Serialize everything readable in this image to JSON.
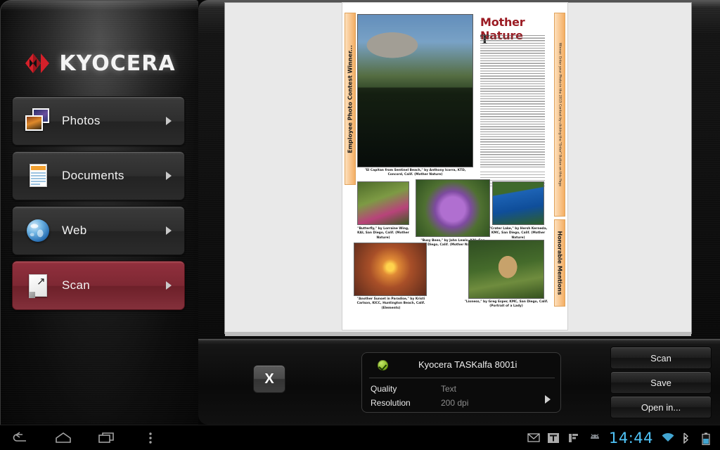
{
  "app": {
    "brand": "KYOCERA",
    "brand_logo_color": "#d4202a"
  },
  "sidebar": {
    "items": [
      {
        "label": "Photos",
        "icon": "photos-icon",
        "selected": false
      },
      {
        "label": "Documents",
        "icon": "documents-icon",
        "selected": false
      },
      {
        "label": "Web",
        "icon": "web-icon",
        "selected": false
      },
      {
        "label": "Scan",
        "icon": "scan-icon",
        "selected": true
      }
    ],
    "selected_color": "#7e2833"
  },
  "preview": {
    "document": {
      "headline": "Mother Nature",
      "headline_color": "#9b1b23",
      "left_banner": "Employee Photo Contest Winner...",
      "right_banner_top": "Winner: Enter your Photo in the 2015 Contest by clicking the \"Enter\" Button on this Page",
      "right_banner_bottom": "Honorable Mentions",
      "banner_color": "#f4ae63",
      "captions": [
        "\"El Capitan from Sentinel Beach,\" by Anthony Icorra, KTD, Concord, Calif. (Mother Nature)",
        "\"Butterfly,\" by Lorraine Wing, KAI, San Diego, Calif. (Mother Nature)",
        "\"Busy Bees,\" by John Lewis, KAI, San Diego, Calif. (Mother Nature)",
        "\"Crater Lake,\" by Hersh Kerneda, KMC, San Diego, Calif. (Mother Nature)",
        "\"Another Sunset in Paradise,\" by Kristi Carlson, KICC, Huntington Beach, Calif. (Elements)",
        "\"Lioness,\" by Greg Esper, KMC, San Diego, Calif. (Portrait of a Lady)"
      ],
      "dropcap": "T"
    }
  },
  "bottom": {
    "close_label": "X",
    "printer": {
      "name": "Kyocera TASKalfa 8001i",
      "status_icon": "check-circle-icon",
      "properties": [
        {
          "label": "Quality",
          "value": "Text"
        },
        {
          "label": "Resolution",
          "value": "200 dpi"
        }
      ]
    },
    "actions": [
      {
        "label": "Scan"
      },
      {
        "label": "Save"
      },
      {
        "label": "Open in..."
      }
    ]
  },
  "systembar": {
    "nav": [
      {
        "icon": "back-icon"
      },
      {
        "icon": "home-icon"
      },
      {
        "icon": "recents-icon"
      },
      {
        "icon": "overflow-menu-icon"
      }
    ],
    "status": [
      {
        "icon": "mail-icon"
      },
      {
        "icon": "text-app-icon"
      },
      {
        "icon": "chart-icon"
      },
      {
        "icon": "android-icon"
      }
    ],
    "clock": "14:44",
    "clock_color": "#4fc3f7",
    "indicators": [
      {
        "icon": "wifi-icon"
      },
      {
        "icon": "bluetooth-icon"
      },
      {
        "icon": "battery-icon"
      }
    ]
  }
}
